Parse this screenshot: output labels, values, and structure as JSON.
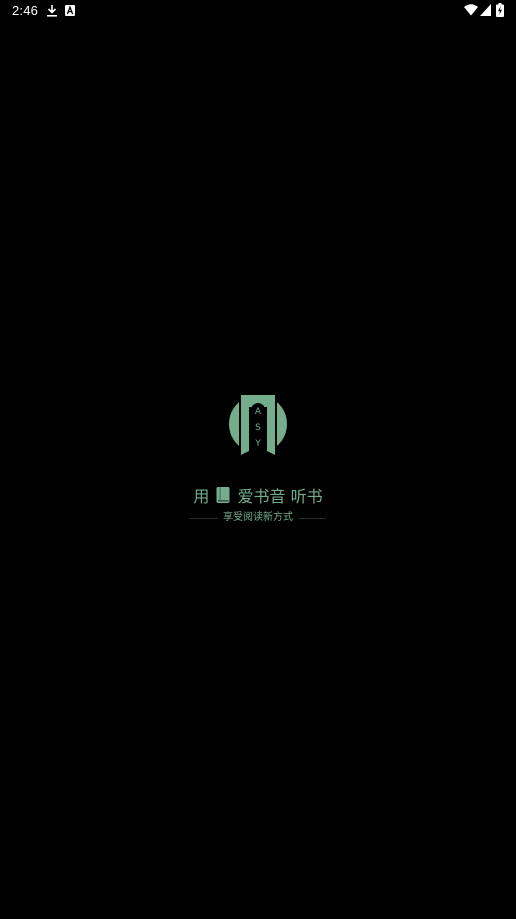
{
  "status_bar": {
    "time": "2:46",
    "icons": [
      "download-icon",
      "a-icon",
      "wifi-icon",
      "signal-icon",
      "battery-charging-icon"
    ]
  },
  "splash": {
    "logo": {
      "letters": [
        "A",
        "S",
        "Y"
      ],
      "color": "#74ad8c"
    },
    "slogan": {
      "part1": "用",
      "part2": "爱书音 听书"
    },
    "subtitle": "享受阅读新方式"
  },
  "colors": {
    "background": "#000000",
    "accent": "#74ad8c",
    "status_text": "#ffffff"
  }
}
